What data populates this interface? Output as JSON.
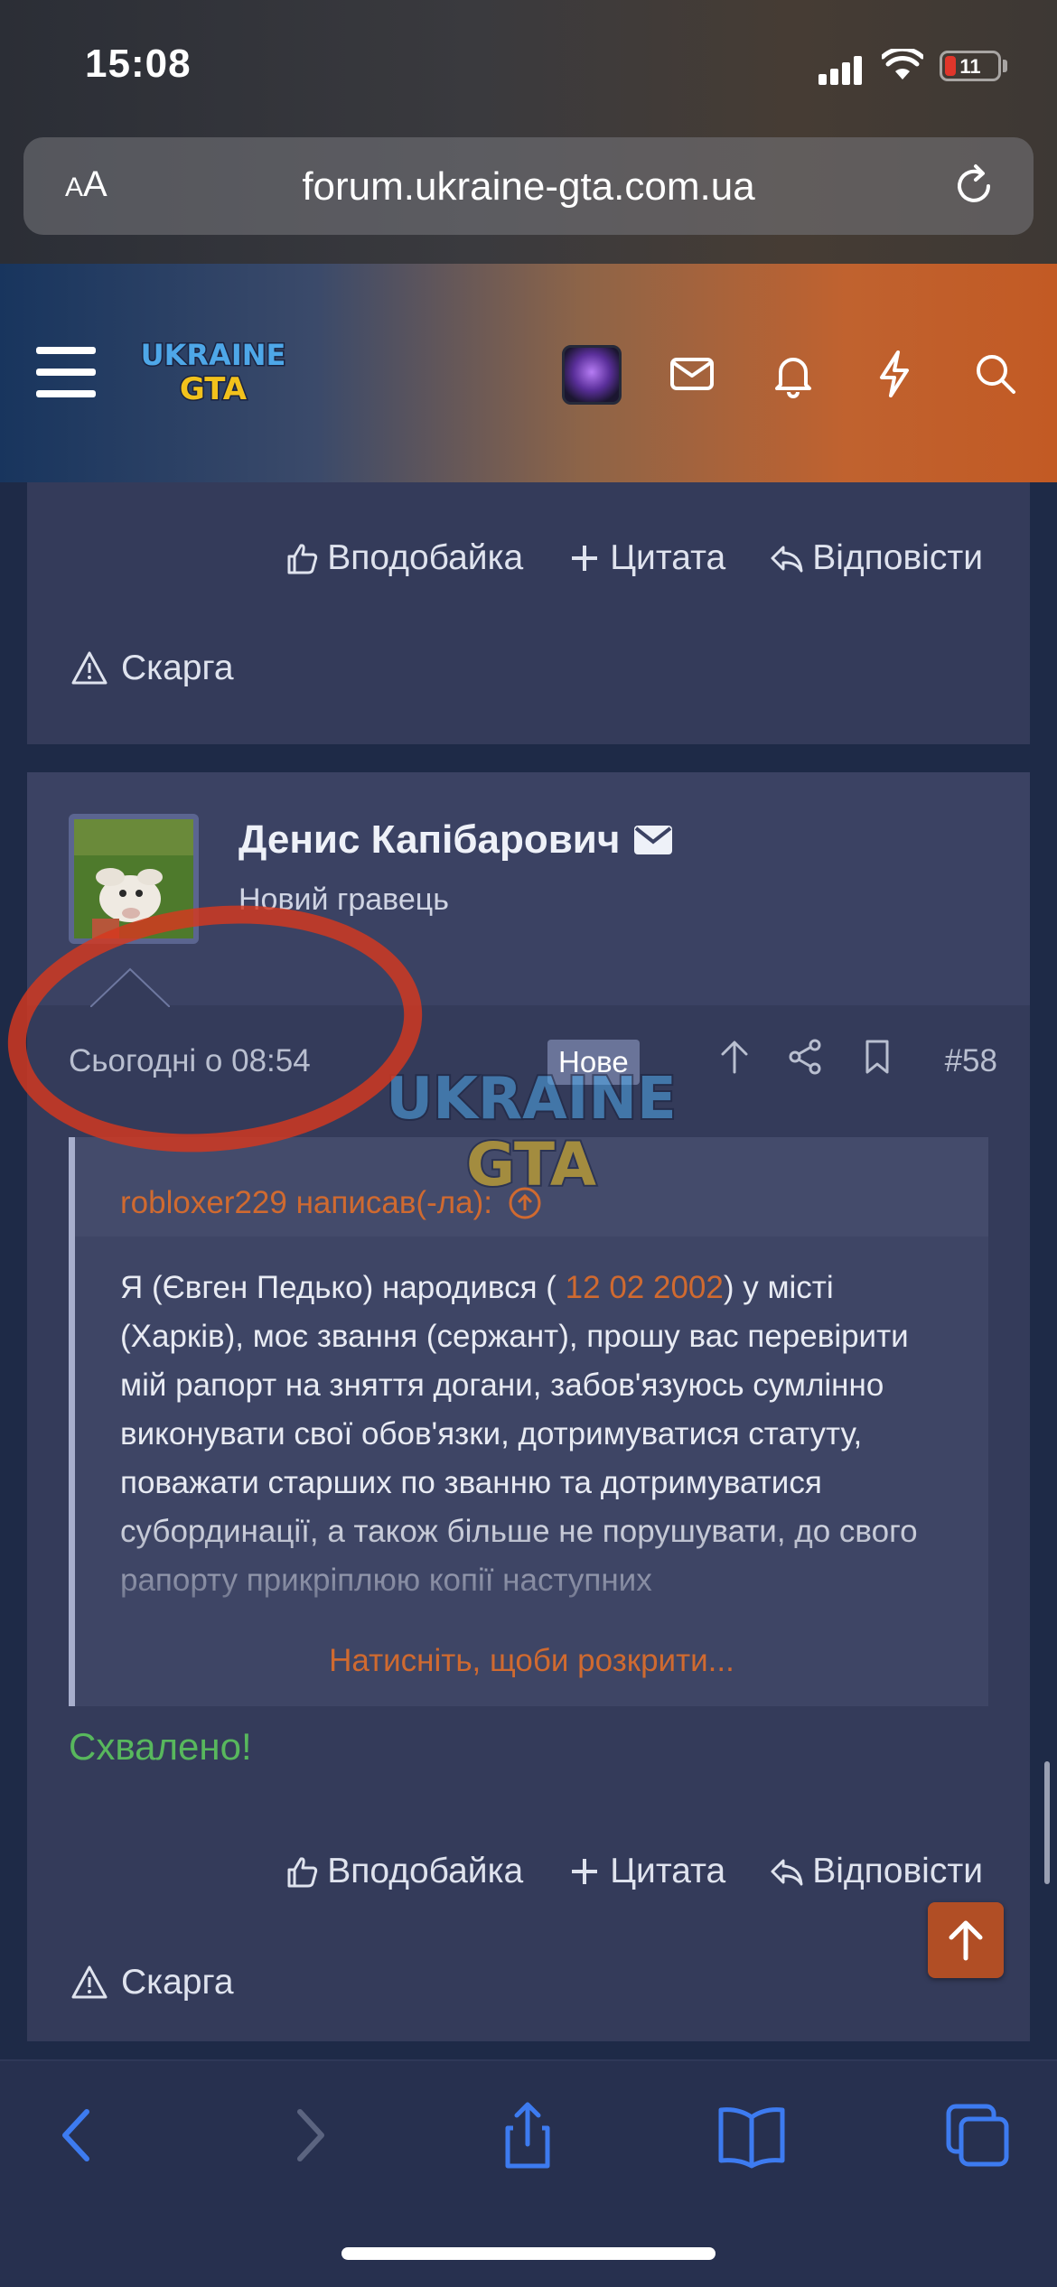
{
  "status_bar": {
    "time": "15:08",
    "battery_level": "11"
  },
  "browser": {
    "text_size_label_small": "A",
    "text_size_label_large": "A",
    "url": "forum.ukraine-gta.com.ua"
  },
  "header": {
    "logo_line1": "UKRAINE",
    "logo_line2": "GTA"
  },
  "post_actions": {
    "like_label": "Вподобайка",
    "quote_label": "Цитата",
    "reply_label": "Відповісти",
    "report_label": "Скарга"
  },
  "post": {
    "author_name": "Денис Капібарович",
    "author_title": "Новий гравець",
    "date": "Сьогодні о 08:54",
    "badge": "Нове",
    "number": "#58",
    "quote": {
      "author_line": "robloxer229 написав(-ла):",
      "text_before": "Я (Євген Педько) народився ( ",
      "date_value": "12 02 2002",
      "text_after": ") у місті (Харків), моє звання (сержант), прошу вас перевірити мій рапорт на зняття догани, забов'язуюсь сумлінно виконувати свої обов'язки, дотримуватися статуту, поважати старших по званню та дотримуватися субординації, а також більше не порушувати, до свого рапорту прикріплюю копії наступних",
      "expand_label": "Натисніть, щоби розкрити..."
    },
    "body": "Схвалено!"
  },
  "colors": {
    "accent": "#d06a30",
    "approved": "#58b85d",
    "card_bg": "#343b5a",
    "page_bg": "#1e2a47",
    "ios_blue": "#3d7bf0",
    "annotation_red": "#d6381e"
  }
}
